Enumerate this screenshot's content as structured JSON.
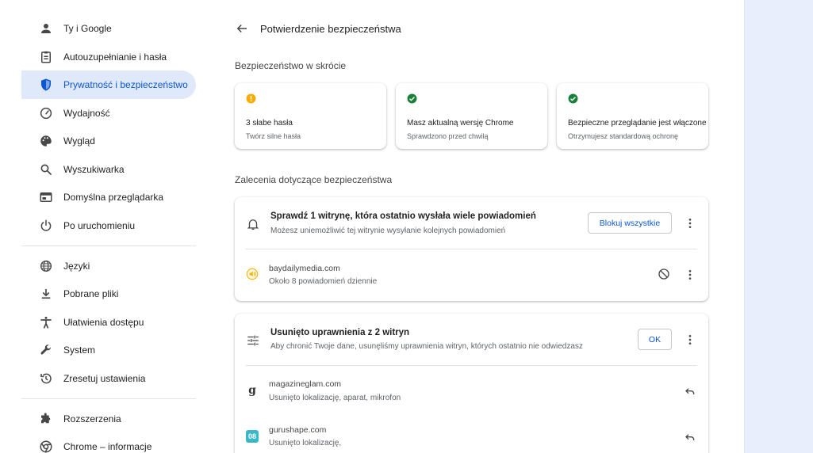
{
  "sidebar": {
    "items": [
      {
        "label": "Ty i Google",
        "icon": "person-icon"
      },
      {
        "label": "Autouzupełnianie i hasła",
        "icon": "clipboard-icon"
      },
      {
        "label": "Prywatność i bezpieczeństwo",
        "icon": "shield-icon",
        "active": true
      },
      {
        "label": "Wydajność",
        "icon": "speedometer-icon"
      },
      {
        "label": "Wygląd",
        "icon": "palette-icon"
      },
      {
        "label": "Wyszukiwarka",
        "icon": "search-icon"
      },
      {
        "label": "Domyślna przeglądarka",
        "icon": "browser-icon"
      },
      {
        "label": "Po uruchomieniu",
        "icon": "power-icon"
      },
      {
        "label": "Języki",
        "icon": "globe-icon"
      },
      {
        "label": "Pobrane pliki",
        "icon": "download-icon"
      },
      {
        "label": "Ułatwienia dostępu",
        "icon": "accessibility-icon"
      },
      {
        "label": "System",
        "icon": "wrench-icon"
      },
      {
        "label": "Zresetuj ustawienia",
        "icon": "reset-history-icon"
      },
      {
        "label": "Rozszerzenia",
        "icon": "puzzle-icon"
      },
      {
        "label": "Chrome – informacje",
        "icon": "chrome-icon"
      }
    ]
  },
  "header": {
    "title": "Potwierdzenie bezpieczeństwa"
  },
  "summary": {
    "title": "Bezpieczeństwo w skrócie",
    "cards": [
      {
        "title": "3 słabe hasła",
        "sub": "Twórz silne hasła",
        "status": "warning",
        "color": "#f9ab00"
      },
      {
        "title": "Masz aktualną wersję Chrome",
        "sub": "Sprawdzono przed chwilą",
        "status": "ok",
        "color": "#188038"
      },
      {
        "title": "Bezpieczne przeglądanie jest włączone",
        "sub": "Otrzymujesz standardową ochronę",
        "status": "ok",
        "color": "#188038"
      }
    ]
  },
  "recommendations": {
    "title": "Zalecenia dotyczące bezpieczeństwa",
    "notifications": {
      "title": "Sprawdź 1 witrynę, która ostatnio wysłała wiele powiadomień",
      "sub": "Możesz uniemożliwić tej witrynie wysyłanie kolejnych powiadomień",
      "button": "Blokuj wszystkie",
      "site": {
        "name": "baydailymedia.com",
        "sub": "Około 8 powiadomień dziennie"
      }
    },
    "permissions": {
      "title": "Usunięto uprawnienia z 2 witryn",
      "sub": "Aby chronić Twoje dane, usunęliśmy uprawnienia witryn, których ostatnio nie odwiedzasz",
      "button": "OK",
      "sites": [
        {
          "name": "magazineglam.com",
          "sub": "Usunięto lokalizację, aparat, mikrofon",
          "favicon_text": "g"
        },
        {
          "name": "gurushape.com",
          "sub": "Usunięto lokalizację,",
          "favicon_text": "08"
        }
      ]
    }
  },
  "colors": {
    "accent": "#0b57d0",
    "active_bg": "#dfe9fa",
    "warning": "#f9ab00",
    "ok": "#188038"
  }
}
